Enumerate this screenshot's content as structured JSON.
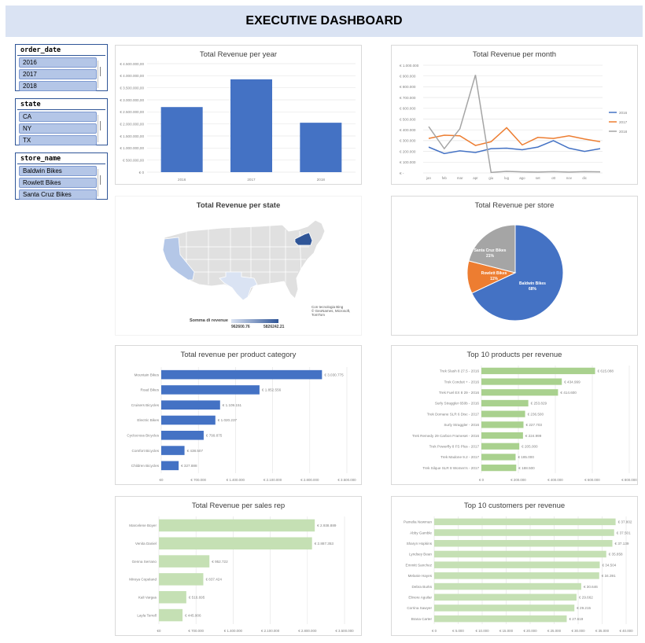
{
  "header": {
    "title": "EXECUTIVE DASHBOARD"
  },
  "slicers": [
    {
      "field": "order_date",
      "items": [
        "2016",
        "2017",
        "2018"
      ]
    },
    {
      "field": "state",
      "items": [
        "CA",
        "NY",
        "TX"
      ]
    },
    {
      "field": "store_name",
      "items": [
        "Baldwin Bikes",
        "Rowlett Bikes",
        "Santa Cruz Bikes"
      ]
    }
  ],
  "colors": {
    "blue": "#4472c4",
    "orange": "#ed7d31",
    "gray": "#a5a5a5",
    "green": "#c5e0b4",
    "header_bg": "#dae3f3"
  },
  "chart_data": [
    {
      "id": "revenue_per_year",
      "type": "bar",
      "title": "Total Revenue per year",
      "categories": [
        "2016",
        "2017",
        "2018"
      ],
      "values": [
        2700000,
        3850000,
        2050000
      ],
      "ylim": [
        0,
        4500000
      ],
      "y_ticks": [
        "€ 0",
        "€ 500.000,00",
        "€ 1.000.000,00",
        "€ 1.500.000,00",
        "€ 2.000.000,00",
        "€ 2.500.000,00",
        "€ 3.000.000,00",
        "€ 3.500.000,00",
        "€ 4.000.000,00",
        "€ 4.500.000,00"
      ],
      "color": "#4472c4",
      "grid": true
    },
    {
      "id": "revenue_per_month",
      "type": "line",
      "title": "Total Revenue per month",
      "categories": [
        "jan",
        "feb",
        "mar",
        "apr",
        "giu",
        "lug",
        "ago",
        "set",
        "ott",
        "nov",
        "dic"
      ],
      "ylim": [
        0,
        1000000
      ],
      "y_ticks": [
        "€ -",
        "€ 100.000",
        "€ 200.000",
        "€ 300.000",
        "€ 400.000",
        "€ 500.000",
        "€ 600.000",
        "€ 700.000",
        "€ 800.000",
        "€ 900.000",
        "€ 1.000.000"
      ],
      "series": [
        {
          "name": "2016",
          "color": "#4472c4",
          "values": [
            240000,
            180000,
            205000,
            190000,
            225000,
            230000,
            215000,
            240000,
            300000,
            230000,
            200000,
            225000
          ]
        },
        {
          "name": "2017",
          "color": "#ed7d31",
          "values": [
            320000,
            350000,
            345000,
            255000,
            290000,
            420000,
            260000,
            330000,
            320000,
            345000,
            315000,
            290000
          ]
        },
        {
          "name": "2018",
          "color": "#a5a5a5",
          "values": [
            430000,
            225000,
            410000,
            910000,
            5000,
            15000,
            10000,
            8000,
            12000,
            8000,
            12000,
            10000
          ]
        }
      ],
      "legend": "right",
      "grid": true
    },
    {
      "id": "revenue_per_state",
      "type": "map",
      "title": "Total Revenue per state",
      "regions": [
        {
          "name": "NY",
          "value": 5826242.21,
          "color": "#2f5597"
        },
        {
          "name": "CA",
          "value": 1605000,
          "color": "#b4c7e7"
        },
        {
          "name": "TX",
          "value": 962600.76,
          "color": "#dae3f3"
        }
      ],
      "legend_title": "Somma di revenue",
      "legend_min": "962600.76",
      "legend_max": "5826242.21",
      "credits": [
        "Con tecnologia Bing",
        "© GeoNames, Microsoft, TomTom"
      ]
    },
    {
      "id": "revenue_per_store",
      "type": "pie",
      "title": "Total Revenue per store",
      "slices": [
        {
          "name": "Baldwin Bikes",
          "label": "68%",
          "value": 68,
          "color": "#4472c4"
        },
        {
          "name": "Rowlett Bikes",
          "label": "11%",
          "value": 11,
          "color": "#ed7d31"
        },
        {
          "name": "Santa Cruz Bikes",
          "label": "21%",
          "value": 21,
          "color": "#a5a5a5"
        }
      ]
    },
    {
      "id": "revenue_per_category",
      "type": "bar",
      "orientation": "horizontal",
      "title": "Total revenue per product category",
      "categories": [
        "Mountain Bikes",
        "Road Bikes",
        "Cruisers Bicycles",
        "Electric Bikes",
        "Cyclocross Bicycles",
        "Comfort Bicycles",
        "Children Bicycles"
      ],
      "values": [
        3030775,
        1852556,
        1109151,
        1020237,
        799875,
        438507,
        327888
      ],
      "labels": [
        "€ 3.030.775",
        "€ 1.852.556",
        "€ 1.109.151",
        "€ 1.020.237",
        "€ 799.875",
        "€ 438.507",
        "€ 327.888"
      ],
      "xlim": [
        0,
        3500000
      ],
      "x_ticks": [
        "€0",
        "€ 700.000",
        "€ 1.400.000",
        "€ 2.100.000",
        "€ 2.800.000",
        "€ 3.500.000"
      ],
      "color": "#4472c4",
      "grid": true
    },
    {
      "id": "top10_products",
      "type": "bar",
      "orientation": "horizontal",
      "title": "Top 10 products per revenue",
      "categories": [
        "Trek Slash 8 27.5 - 2016",
        "Trek Conduit + - 2016",
        "Trek Fuel EX 8 29 - 2016",
        "Surly Straggler 650b - 2016",
        "Trek Domane SLR 6 Disc - 2017",
        "Surly Straggler - 2016",
        "Trek Remedy 29 Carbon Frameset - 2016",
        "Trek Powerfly 8 FS Plus - 2017",
        "Trek Madone 9.2 - 2017",
        "Trek Silque SLR 8 Women's - 2017"
      ],
      "values": [
        615088,
        434999,
        414600,
        253829,
        236500,
        227703,
        224999,
        205000,
        185000,
        188500
      ],
      "labels": [
        "€ 615.088",
        "€ 434.999",
        "€ 414.600",
        "€ 253.829",
        "€ 236.500",
        "€ 227.703",
        "€ 224.999",
        "€ 205.000",
        "€ 185.000",
        "€ 188.500"
      ],
      "xlim": [
        0,
        800000
      ],
      "x_ticks": [
        "€ 0",
        "€ 200.000",
        "€ 400.000",
        "€ 600.000",
        "€ 800.000"
      ],
      "color": "#a9d18e",
      "grid": true
    },
    {
      "id": "revenue_per_sales_rep",
      "type": "bar",
      "orientation": "horizontal",
      "title": "Total Revenue per sales rep",
      "categories": [
        "Marcelene Boyer",
        "Venita Daniel",
        "Genna Serrano",
        "Mireya Copeland",
        "Kali Vargas",
        "Layla Terrell"
      ],
      "values": [
        2938889,
        2887353,
        952722,
        837424,
        516695,
        445906
      ],
      "labels": [
        "€ 2.938.889",
        "€ 2.887.353",
        "€ 952.722",
        "€ 837.424",
        "€ 516.695",
        "€ 445.906"
      ],
      "xlim": [
        0,
        3500000
      ],
      "x_ticks": [
        "€0",
        "€ 700.000",
        "€ 1.400.000",
        "€ 2.100.000",
        "€ 2.800.000",
        "€ 3.500.000"
      ],
      "color": "#c5e0b4",
      "grid": true
    },
    {
      "id": "top10_customers",
      "type": "bar",
      "orientation": "horizontal",
      "title": "Top 10 customers per revenue",
      "categories": [
        "Pamelia Newman",
        "Abby Gamble",
        "Sharyn Hopkins",
        "Lyndsey Bean",
        "Emmitt Sanchez",
        "Melanie Hayes",
        "Debra Burks",
        "Elinore Aguilar",
        "Corrina Sawyer",
        "Brana Carter"
      ],
      "values": [
        37802,
        37501,
        37139,
        35858,
        34504,
        34391,
        30646,
        29662,
        29215,
        27619
      ],
      "labels": [
        "€ 37.802",
        "€ 37.501",
        "€ 37.139",
        "€ 35.858",
        "€ 34.504",
        "€ 34.391",
        "€ 30.646",
        "€ 29.662",
        "€ 29.215",
        "€ 27.619"
      ],
      "xlim": [
        0,
        40000
      ],
      "x_ticks": [
        "€ 0",
        "€ 5.000",
        "€ 10.000",
        "€ 15.000",
        "€ 20.000",
        "€ 25.000",
        "€ 30.000",
        "€ 35.000",
        "€ 40.000"
      ],
      "color": "#c5e0b4",
      "grid": true
    }
  ]
}
